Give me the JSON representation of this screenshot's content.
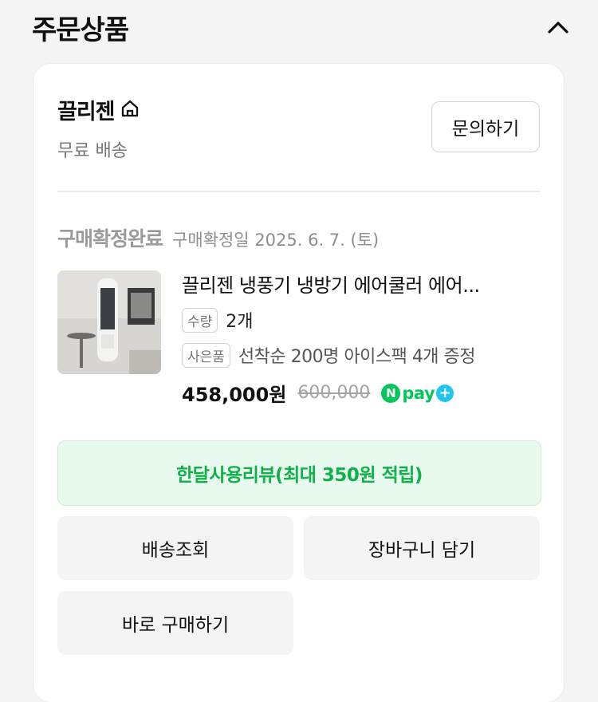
{
  "section": {
    "title": "주문상품",
    "collapse_icon": "chevron-up-icon"
  },
  "seller": {
    "name": "끌리젠",
    "store_icon": "home-icon",
    "shipping": "무료 배송",
    "inquiry_label": "문의하기"
  },
  "order": {
    "status": "구매확정완료",
    "confirm_date": "구매확정일 2025. 6. 7. (토)"
  },
  "product": {
    "name": "끌리젠 냉풍기 냉방기 에어쿨러 에어...",
    "qty_tag": "수량",
    "qty": "2개",
    "gift_tag": "사은품",
    "gift": "선착순 200명 아이스팩 4개 증정",
    "price": "458,000원",
    "original_price": "600,000",
    "npay": {
      "n": "N",
      "pay": "pay",
      "plus": "+"
    }
  },
  "actions": {
    "review": "한달사용리뷰(최대 350원 적립)",
    "track": "배송조회",
    "cart": "장바구니 담기",
    "buy_now": "바로 구매하기"
  },
  "colors": {
    "accent_green": "#10b04a",
    "review_bg": "#e8f9ee",
    "npay_green": "#03c75a",
    "npay_blue": "#1ec5f0"
  }
}
